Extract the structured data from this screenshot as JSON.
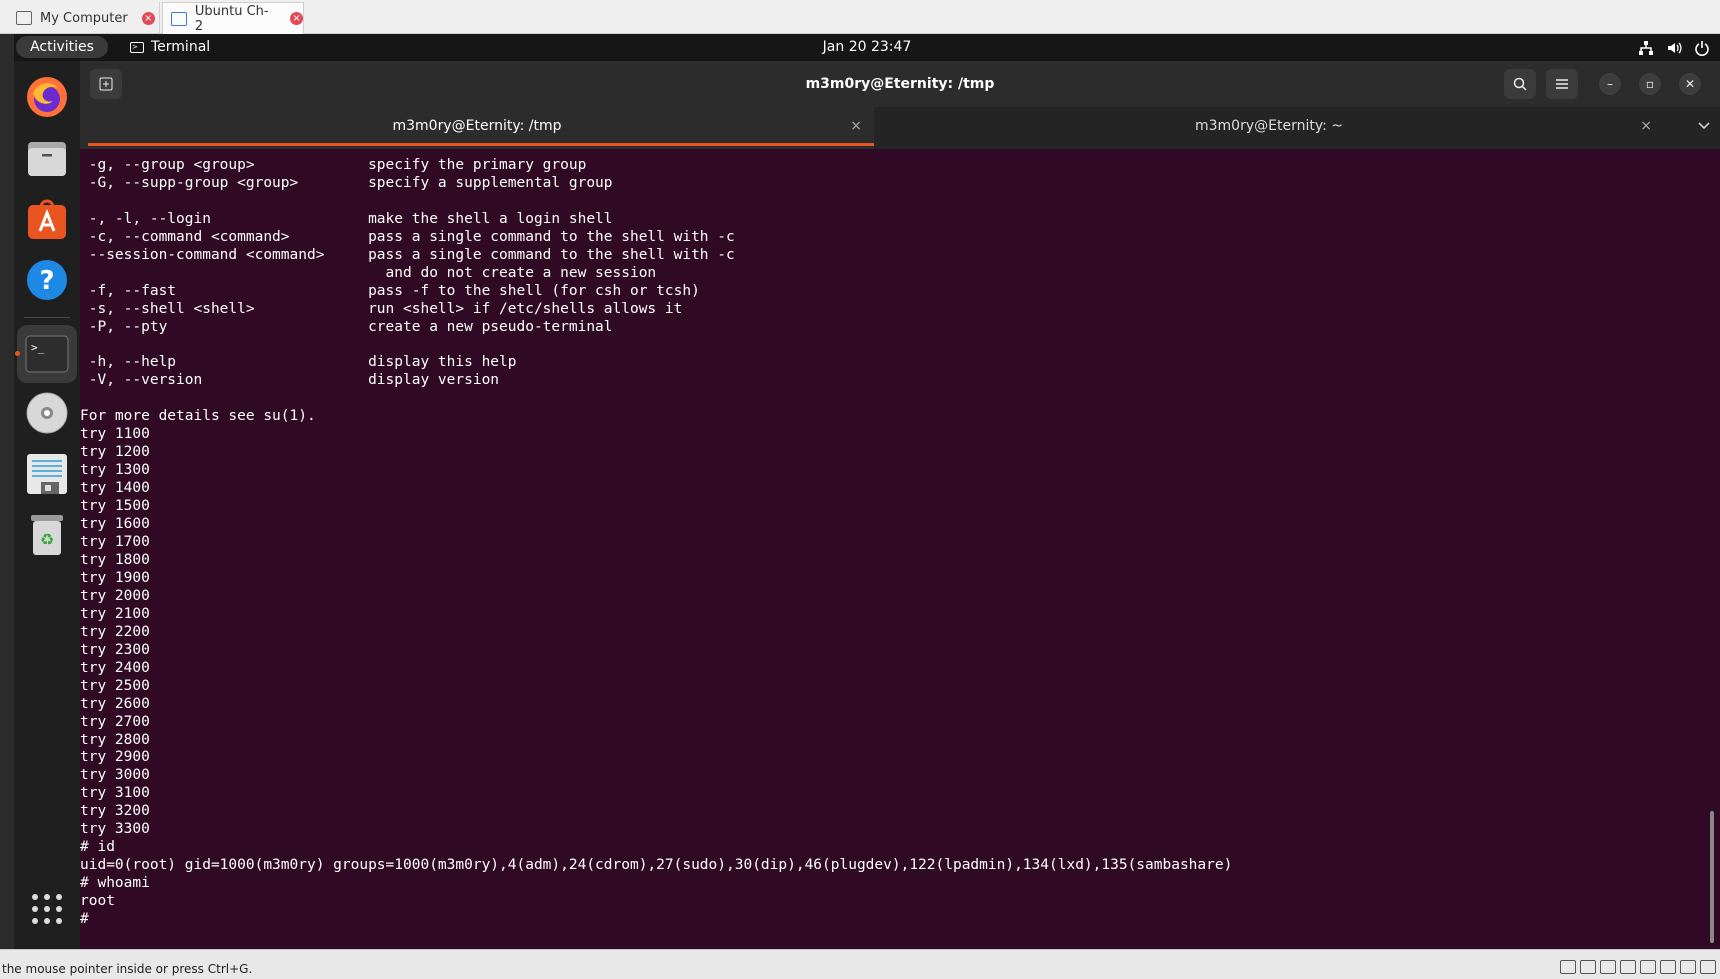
{
  "vm_tabs": [
    {
      "label": "My Computer",
      "icon": "monitor-icon"
    },
    {
      "label": "Ubuntu Ch-2",
      "icon": "vm-icon"
    }
  ],
  "topbar": {
    "activities": "Activities",
    "app_name": "Terminal",
    "clock": "Jan 20  23:47",
    "icons": [
      "network-icon",
      "volume-icon",
      "power-icon"
    ]
  },
  "dock": {
    "items": [
      "firefox-icon",
      "files-icon",
      "app-center-icon",
      "help-icon",
      "terminal-icon",
      "disc-icon",
      "text-editor-icon",
      "trash-icon",
      "show-apps-icon"
    ]
  },
  "window": {
    "title": "m3m0ry@Eternity: /tmp",
    "tabs": [
      {
        "label": "m3m0ry@Eternity: /tmp",
        "active": true
      },
      {
        "label": "m3m0ry@Eternity: ~",
        "active": false
      }
    ]
  },
  "terminal": {
    "lines": [
      " -g, --group <group>             specify the primary group",
      " -G, --supp-group <group>        specify a supplemental group",
      "",
      " -, -l, --login                  make the shell a login shell",
      " -c, --command <command>         pass a single command to the shell with -c",
      " --session-command <command>     pass a single command to the shell with -c",
      "                                   and do not create a new session",
      " -f, --fast                      pass -f to the shell (for csh or tcsh)",
      " -s, --shell <shell>             run <shell> if /etc/shells allows it",
      " -P, --pty                       create a new pseudo-terminal",
      "",
      " -h, --help                      display this help",
      " -V, --version                   display version",
      "",
      "For more details see su(1).",
      "try 1100",
      "try 1200",
      "try 1300",
      "try 1400",
      "try 1500",
      "try 1600",
      "try 1700",
      "try 1800",
      "try 1900",
      "try 2000",
      "try 2100",
      "try 2200",
      "try 2300",
      "try 2400",
      "try 2500",
      "try 2600",
      "try 2700",
      "try 2800",
      "try 2900",
      "try 3000",
      "try 3100",
      "try 3200",
      "try 3300",
      "# id",
      "uid=0(root) gid=1000(m3m0ry) groups=1000(m3m0ry),4(adm),24(cdrom),27(sudo),30(dip),46(plugdev),122(lpadmin),134(lxd),135(sambashare)",
      "# whoami",
      "root",
      "# "
    ]
  },
  "status_bar": {
    "message": "the mouse pointer inside or press Ctrl+G."
  },
  "colors": {
    "terminal_bg": "#300a24",
    "accent": "#e95420"
  }
}
